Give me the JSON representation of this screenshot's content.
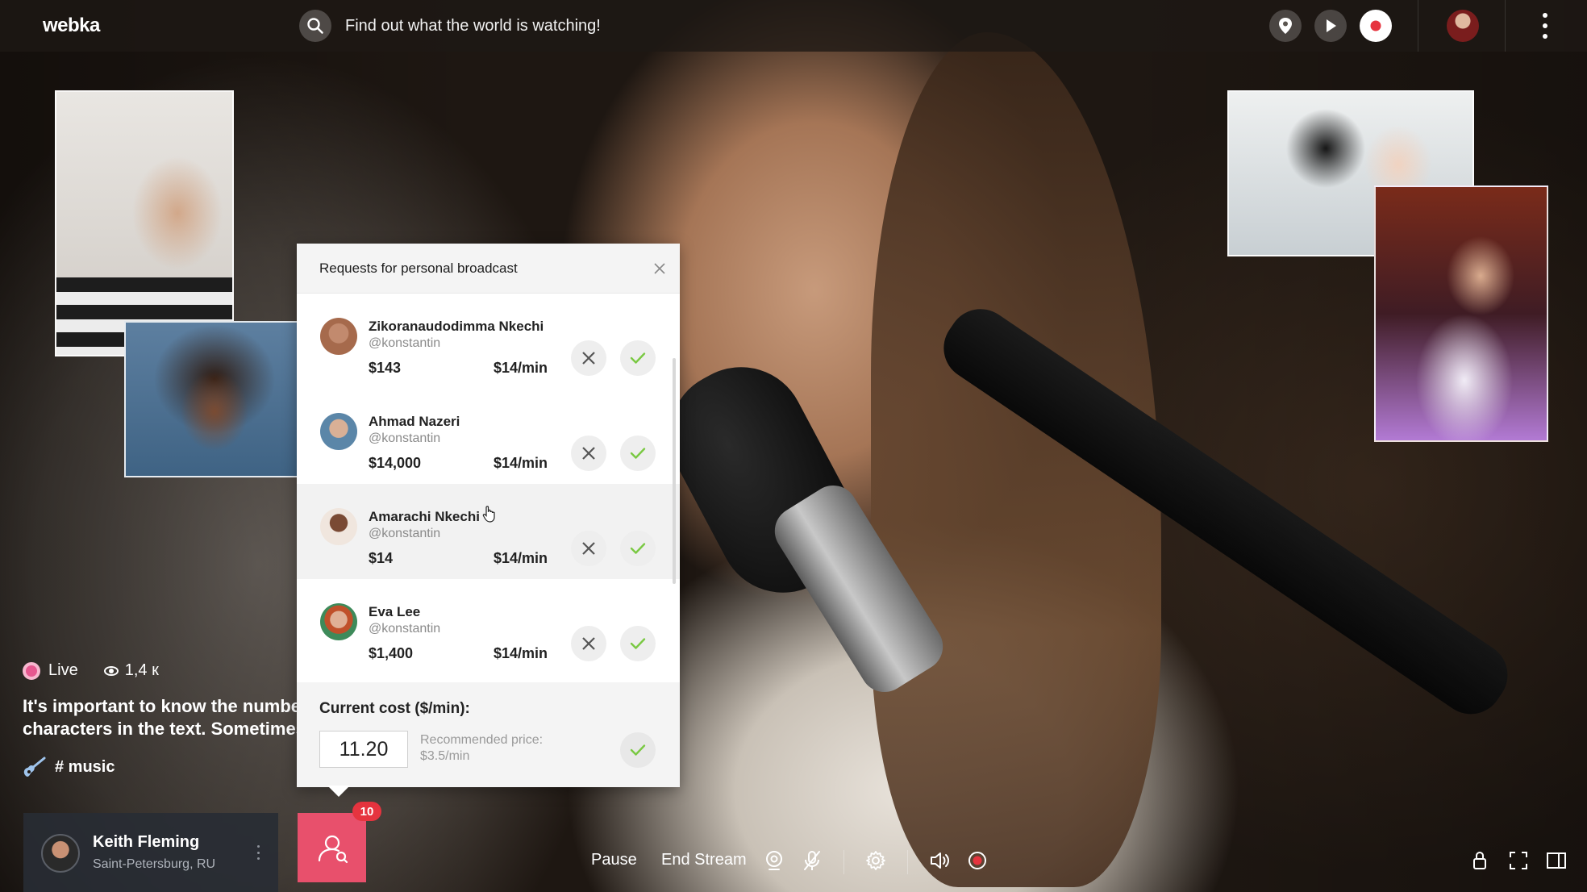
{
  "app": {
    "logo": "webka",
    "search_placeholder": "Find out what the world is watching!"
  },
  "topbar": {
    "icons": [
      "location-pin-icon",
      "play-icon",
      "record-icon",
      "user-avatar",
      "more-vertical-icon"
    ]
  },
  "stream": {
    "live_label": "Live",
    "viewers": "1,4 к",
    "caption": "It's important to know the number of characters in the text. Sometimes",
    "caption_line1": "It's important to know the numbe",
    "caption_line2": "characters in the text. Sometimes",
    "tag": "# music"
  },
  "streamer": {
    "name": "Keith Fleming",
    "location": "Saint-Petersburg, RU"
  },
  "requests_button": {
    "badge": "10"
  },
  "panel": {
    "title": "Requests for personal broadcast",
    "requests": [
      {
        "name": "Zikoranaudodimma Nkechi",
        "handle": "@konstantin",
        "amount": "$143",
        "rate": "$14/min",
        "avatar_color": "#a66a4c"
      },
      {
        "name": "Ahmad Nazeri",
        "handle": "@konstantin",
        "amount": "$14,000",
        "rate": "$14/min",
        "avatar_color": "#5b86a8"
      },
      {
        "name": "Amarachi Nkechi",
        "handle": "@konstantin",
        "amount": "$14",
        "rate": "$14/min",
        "avatar_color": "#d9c2b4"
      },
      {
        "name": "Eva Lee",
        "handle": "@konstantin",
        "amount": "$1,400",
        "rate": "$14/min",
        "avatar_color": "#3e8a5a"
      }
    ],
    "cost_label": "Current cost ($/min):",
    "cost_value": "11.20",
    "recommended_line1": "Recommended price:",
    "recommended_line2": "$3.5/min"
  },
  "controls": {
    "pause": "Pause",
    "end_stream": "End Stream"
  },
  "colors": {
    "accept_green": "#7ac943",
    "accent_pink": "#e8506c",
    "badge_red": "#e6343f",
    "live_pink": "#e6578f"
  }
}
